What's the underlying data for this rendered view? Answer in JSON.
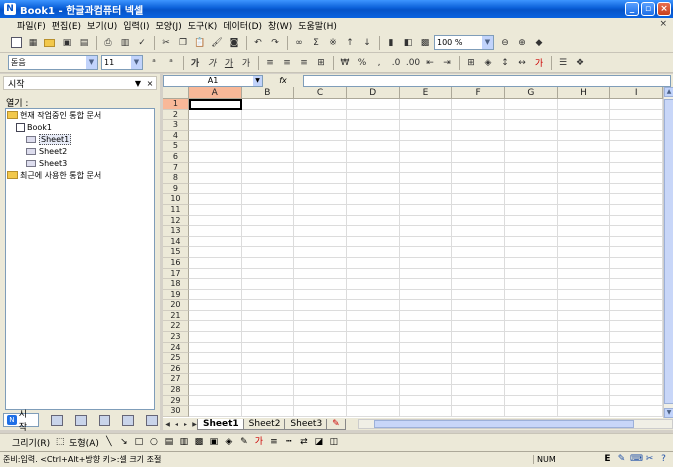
{
  "window": {
    "title": "Book1 - 한글과컴퓨터 넥셀",
    "app_icon": "N"
  },
  "menubar": {
    "items": [
      "파일(F)",
      "편집(E)",
      "보기(U)",
      "입력(I)",
      "모양(J)",
      "도구(K)",
      "데이터(D)",
      "창(W)",
      "도움말(H)"
    ]
  },
  "toolbar2": {
    "font_name": "돋음",
    "font_size": "11"
  },
  "toolbar1": {
    "zoom": "100 %"
  },
  "taskpane": {
    "title": "시작",
    "open_label": "열기 :",
    "tree": {
      "current_docs": "현재 작업중인 통합 문서",
      "book": "Book1",
      "sheets": [
        "Sheet1",
        "Sheet2",
        "Sheet3"
      ],
      "recent_docs": "최근에 사용한 통합 문서"
    },
    "bottom": {
      "start_label": "시작"
    }
  },
  "formulabar": {
    "name_box": "A1",
    "fx_label": "fx"
  },
  "grid": {
    "columns": [
      "A",
      "B",
      "C",
      "D",
      "E",
      "F",
      "G",
      "H",
      "I"
    ],
    "rows": [
      "1",
      "2",
      "3",
      "4",
      "5",
      "6",
      "7",
      "8",
      "9",
      "10",
      "11",
      "12",
      "13",
      "14",
      "15",
      "16",
      "17",
      "18",
      "19",
      "20",
      "21",
      "22",
      "23",
      "24",
      "25",
      "26",
      "27",
      "28",
      "29",
      "30"
    ],
    "active_cell": "A1"
  },
  "sheet_tabs": [
    "Sheet1",
    "Sheet2",
    "Sheet3"
  ],
  "drawbar": {
    "draw_label": "그리기(R)",
    "shape_label": "도형(A)"
  },
  "status": {
    "text": "준비:입력. <Ctrl+Alt+방향 키>:셀 크기 조절",
    "num": "NUM"
  },
  "colors": {
    "title_bar": "#0a5fd8",
    "active_header": "#f8b898",
    "chrome": "#ece9d8"
  }
}
